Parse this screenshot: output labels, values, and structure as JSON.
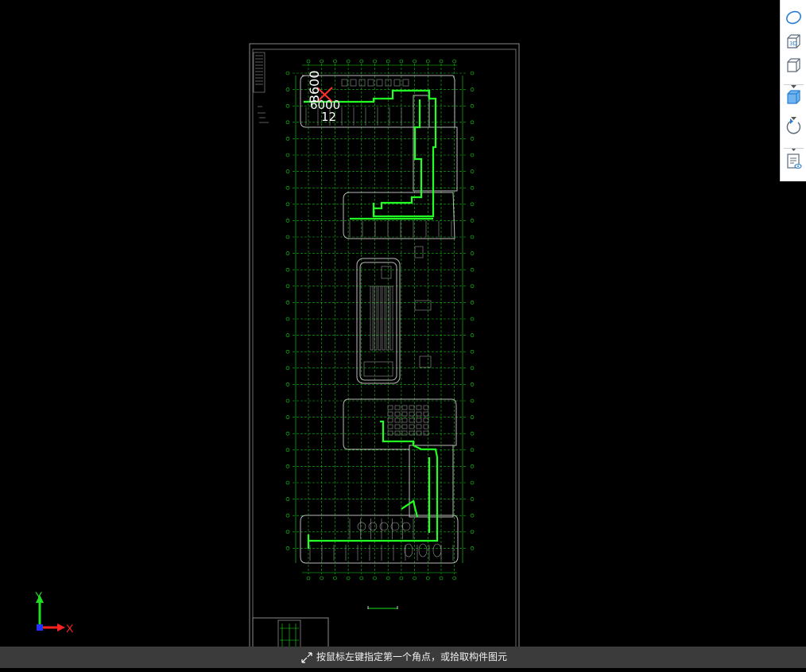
{
  "colors": {
    "background": "#000000",
    "sheet_border": "#8a8a8a",
    "grid_green": "#18e018",
    "route_green": "#22ff22",
    "walls": "#b8b8b8",
    "marker_red": "#ff3030",
    "toolbar_bg": "#ffffff",
    "toolbar_icon": "#2a7fd4",
    "status_bg": "#3b3b3b"
  },
  "toolbar": {
    "buttons": [
      {
        "name": "view-ellipse-icon"
      },
      {
        "name": "view-3d-icon",
        "label": "3D"
      },
      {
        "name": "view-cube-outline-icon"
      },
      {
        "name": "view-cube-filled-icon"
      },
      {
        "name": "orbit-rotate-icon"
      },
      {
        "name": "properties-panel-icon"
      }
    ]
  },
  "drawing": {
    "overlay_text_line1": "B600",
    "overlay_text_line2": "6000",
    "overlay_text_line3": "12"
  },
  "ucs": {
    "y_label": "Y",
    "x_label": "X",
    "y_color": "#22dd22",
    "x_color": "#ff2222",
    "origin_color": "#2233ff"
  },
  "status": {
    "prompt": "按鼠标左键指定第一个角点，或拾取构件图元"
  }
}
